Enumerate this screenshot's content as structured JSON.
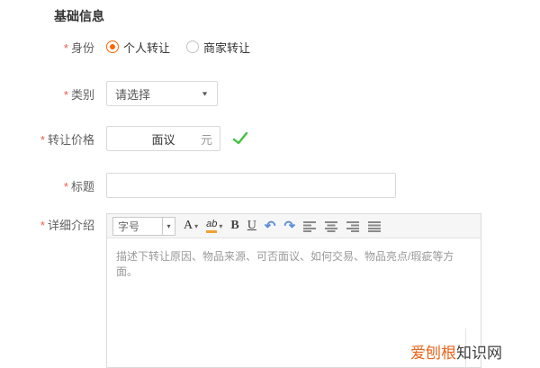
{
  "heading": "基础信息",
  "required_marker": "*",
  "identity": {
    "label": "身份",
    "options": [
      {
        "label": "个人转让",
        "selected": true
      },
      {
        "label": "商家转让",
        "selected": false
      }
    ]
  },
  "category": {
    "label": "类别",
    "value": "请选择"
  },
  "price": {
    "label": "转让价格",
    "value": "面议",
    "unit": "元",
    "status": "valid"
  },
  "title_field": {
    "label": "标题",
    "value": "",
    "placeholder": ""
  },
  "description": {
    "label": "详细介绍",
    "placeholder": "描述下转让原因、物品来源、可否面议、如何交易、物品亮点/瑕疵等方面。",
    "toolbar": {
      "font_size": "字号",
      "font_color": "A",
      "highlight": "ab",
      "bold": "B",
      "underline": "U"
    }
  },
  "icons": {
    "caret_down": "▼",
    "caret_small": "▾",
    "undo": "↶",
    "redo": "↷"
  },
  "watermark": {
    "brand_primary": "爱刨根",
    "brand_secondary": "知识网"
  },
  "colors": {
    "accent_orange": "#ff6600",
    "required_red": "#f25c4a",
    "check_green": "#3fc13f",
    "undo_blue": "#5b8dd9",
    "watermark_orange": "#e8641b",
    "toolbar_bg": "#f6f6f6",
    "border_gray": "#d9d9d9"
  }
}
